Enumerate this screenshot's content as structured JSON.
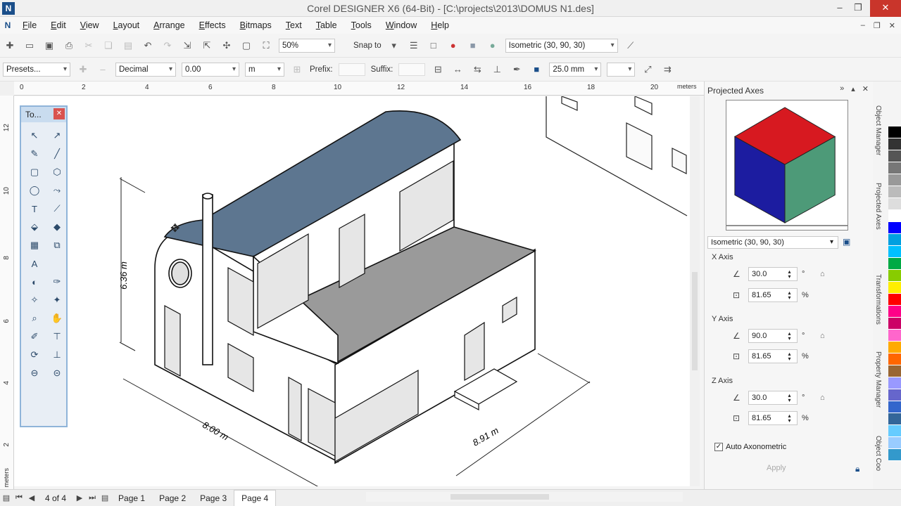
{
  "app": {
    "title": "Corel DESIGNER X6 (64-Bit) - [C:\\projects\\2013\\DOMUS N1.des]"
  },
  "window_controls": {
    "minimize": "–",
    "restore": "❐",
    "close": "✕"
  },
  "menu": [
    "File",
    "Edit",
    "View",
    "Layout",
    "Arrange",
    "Effects",
    "Bitmaps",
    "Text",
    "Table",
    "Tools",
    "Window",
    "Help"
  ],
  "toolbar1": {
    "zoom": "50%",
    "snap_to": "Snap to",
    "projection": "Isometric (30, 90, 30)"
  },
  "toolbar2": {
    "presets": "Presets...",
    "format": "Decimal",
    "value": "0.00",
    "unit": "m",
    "prefix_label": "Prefix:",
    "suffix_label": "Suffix:",
    "size": "25.0 mm"
  },
  "rulers": {
    "h_ticks": [
      "0",
      "2",
      "4",
      "6",
      "8",
      "10",
      "12",
      "14",
      "16",
      "18",
      "20"
    ],
    "h_unit": "meters",
    "v_ticks": [
      "12",
      "10",
      "8",
      "6",
      "4",
      "2"
    ],
    "v_unit": "meters"
  },
  "toolbox": {
    "title": "To..."
  },
  "drawing": {
    "dim_height": "6.36 m",
    "dim_width": "8.00 m",
    "dim_depth": "8.91 m"
  },
  "docker": {
    "title": "Projected Axes",
    "preset": "Isometric (30, 90, 30)",
    "x_axis": {
      "label": "X Axis",
      "angle": "30.0",
      "scale": "81.65"
    },
    "y_axis": {
      "label": "Y Axis",
      "angle": "90.0",
      "scale": "81.65"
    },
    "z_axis": {
      "label": "Z Axis",
      "angle": "30.0",
      "scale": "81.65"
    },
    "degree": "°",
    "percent": "%",
    "auto_axonometric": "Auto Axonometric",
    "apply": "Apply",
    "cube_colors": {
      "top": "#d71920",
      "left": "#1c1ca0",
      "right": "#4d9a78"
    }
  },
  "side_tabs": [
    "Object Manager",
    "Projected Axes",
    "Transformations",
    "Property Manager",
    "Object Coo"
  ],
  "palette": [
    "#000000",
    "#333333",
    "#555555",
    "#777777",
    "#999999",
    "#bbbbbb",
    "#dddddd",
    "#ffffff",
    "#0000ff",
    "#00a0e0",
    "#00c0ff",
    "#00aa44",
    "#88cc00",
    "#ffee00",
    "#ff0000",
    "#ff0088",
    "#cc0066",
    "#ff66cc",
    "#ffaa00",
    "#ff6600",
    "#996633",
    "#9999ff",
    "#6666cc",
    "#3366cc",
    "#336699",
    "#66ccff",
    "#99ccff",
    "#3399cc"
  ],
  "pages": {
    "count": "4 of 4",
    "tabs": [
      "Page 1",
      "Page 2",
      "Page 3",
      "Page 4"
    ],
    "active": "Page 4"
  }
}
